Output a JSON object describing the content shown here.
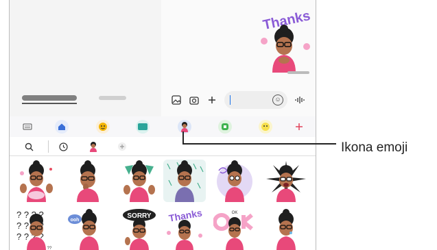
{
  "callout": {
    "label": "Ikona emoji"
  },
  "sticker_message": {
    "text": "Thanks"
  },
  "stickers": [
    {
      "label": ""
    },
    {
      "label": ""
    },
    {
      "label": ""
    },
    {
      "label": ""
    },
    {
      "label": ""
    },
    {
      "label": ""
    },
    {
      "label": "??"
    },
    {
      "label": "ooh"
    },
    {
      "label": "SORRY"
    },
    {
      "label": "Thanks"
    },
    {
      "label": "OK"
    },
    {
      "label": ""
    }
  ],
  "colors": {
    "accent_blue": "#1a73e8",
    "avatar_skin": "#b5734f",
    "hat_black": "#1f1f1f",
    "shirt_pink": "#e8497a",
    "sticker_purple": "#8a5bd6"
  }
}
